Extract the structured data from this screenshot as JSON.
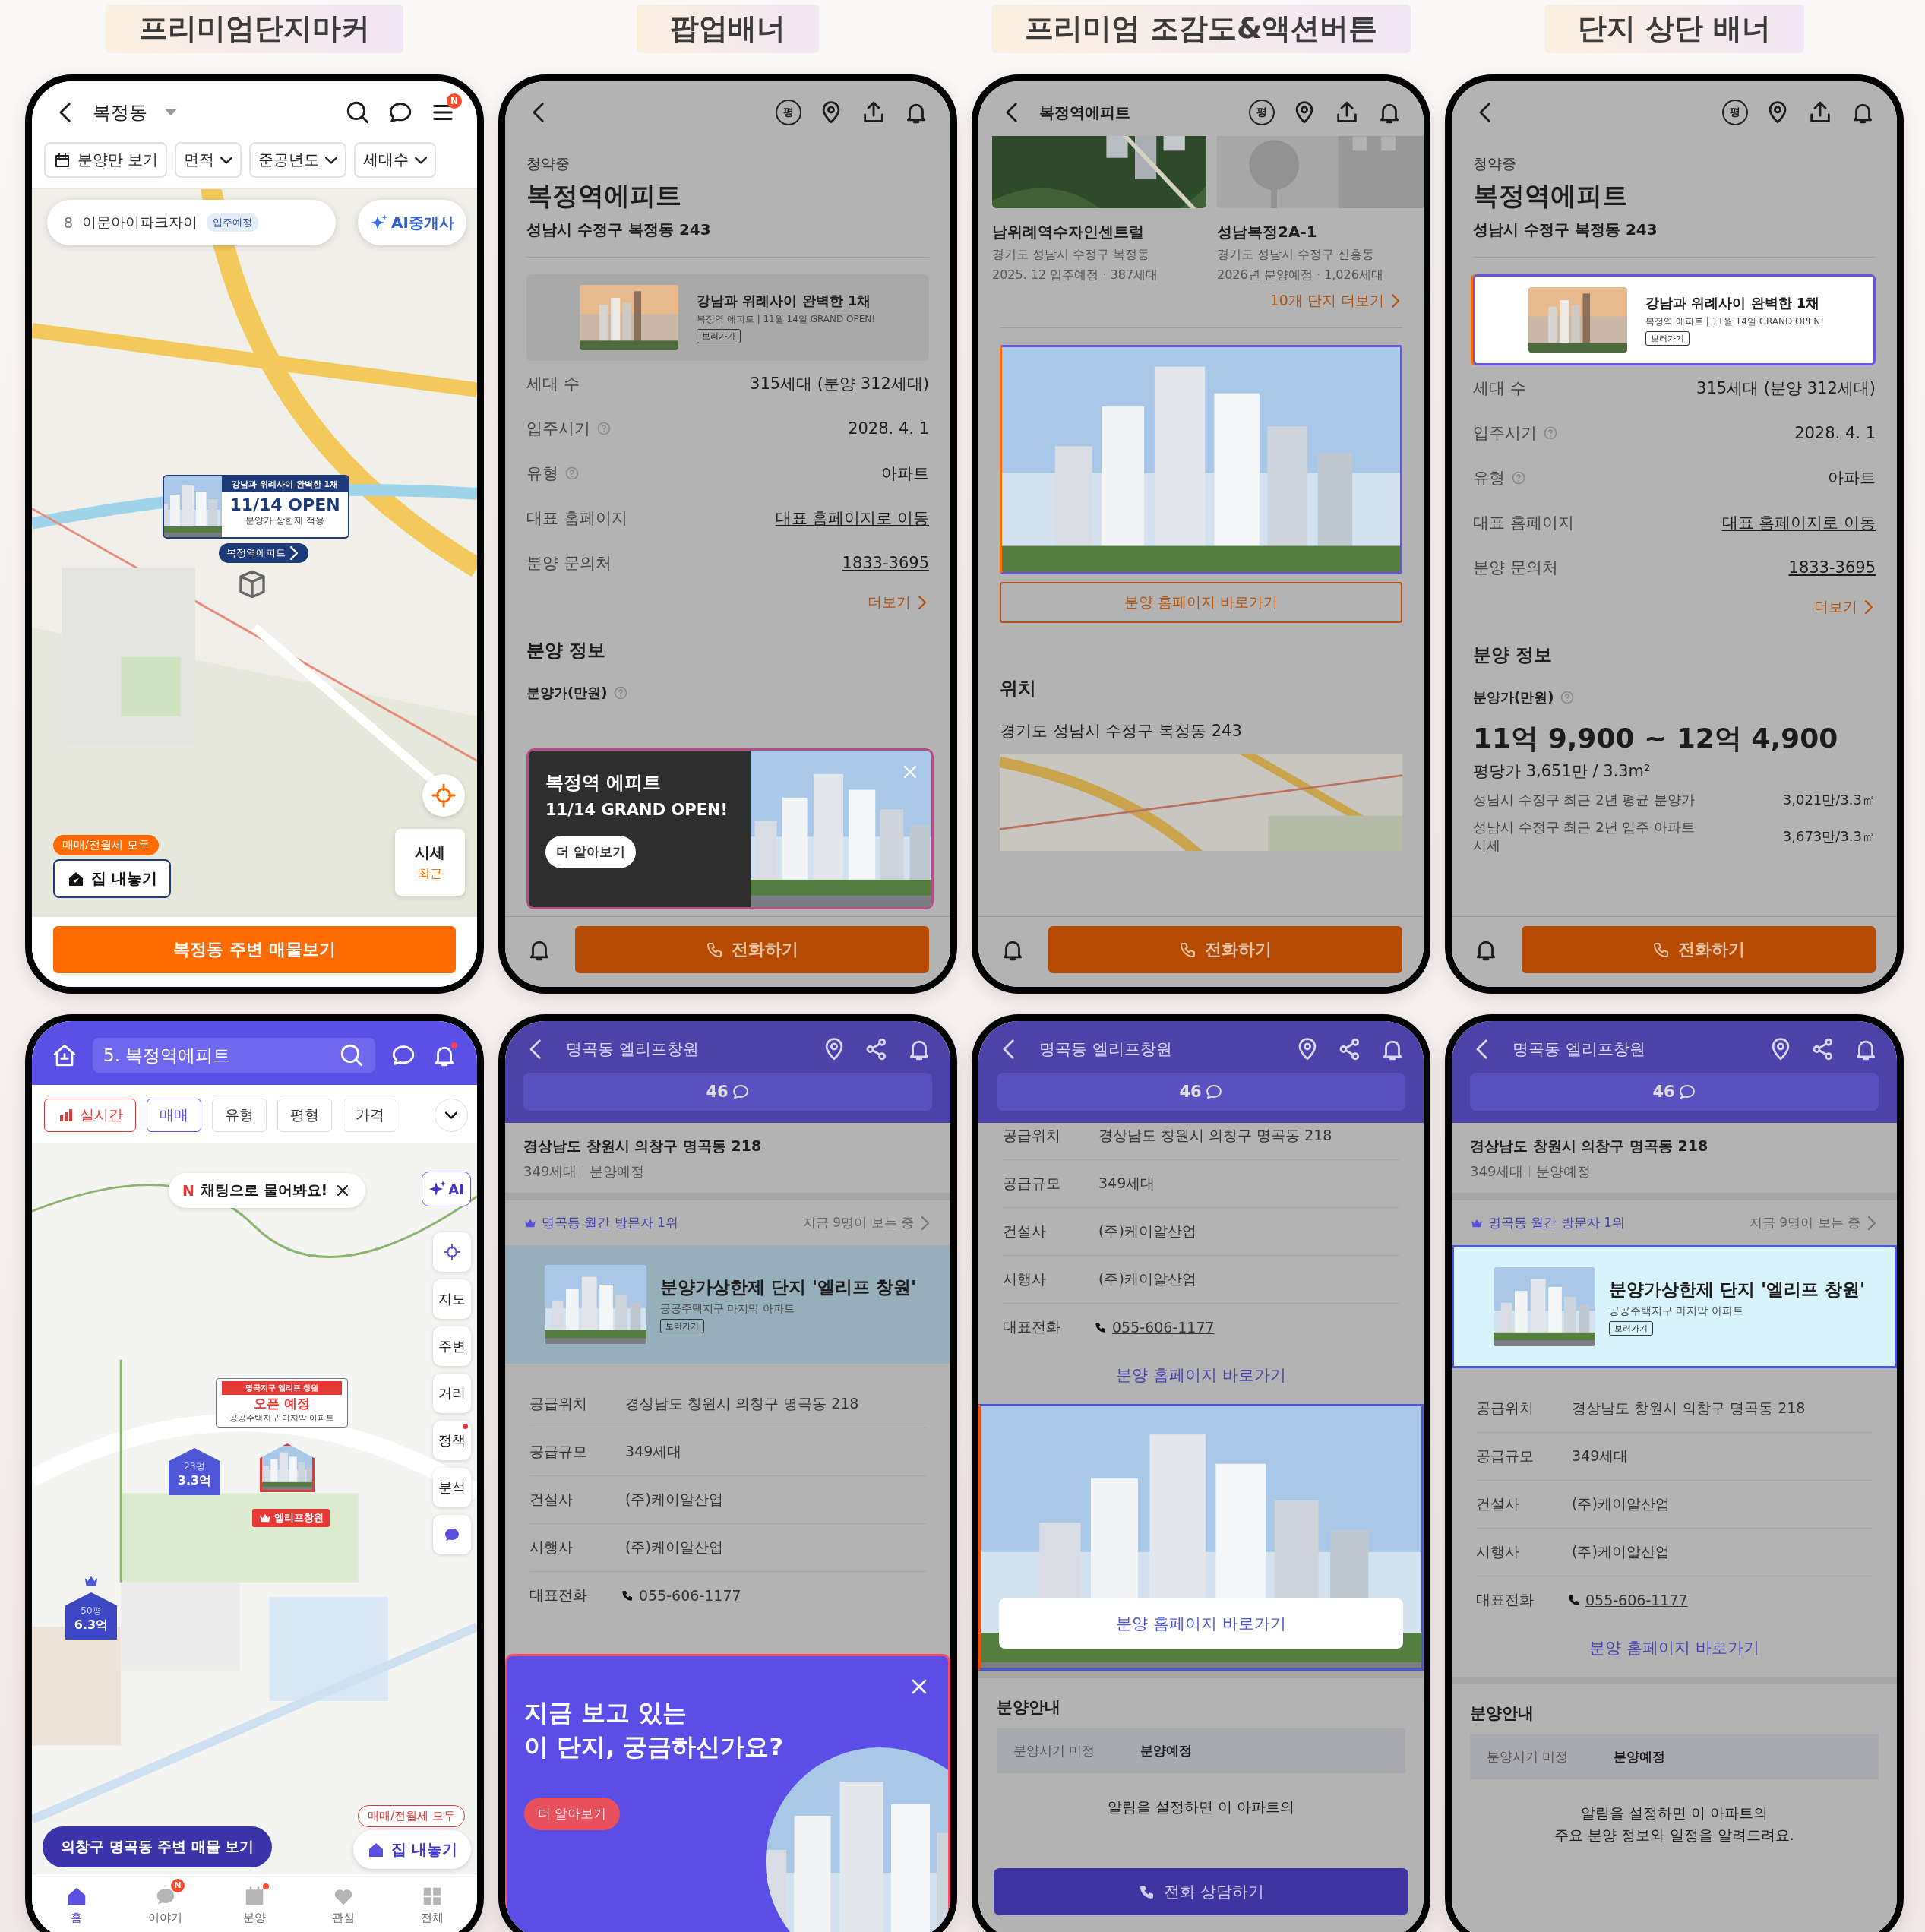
{
  "section_labels": [
    "프리미엄단지마커",
    "팝업배너",
    "프리미엄 조감도&액션버튼",
    "단지 상단 배너"
  ],
  "phones": [
    {
      "kind": "map_orange",
      "title": "복정동",
      "menu_badge": "N",
      "filters": [
        {
          "label": "분양만 보기",
          "kind": "toggle"
        },
        {
          "label": "면적",
          "kind": "dropdown"
        },
        {
          "label": "준공년도",
          "kind": "dropdown"
        },
        {
          "label": "세대수",
          "kind": "dropdown"
        }
      ],
      "search_chip": {
        "rank": "8",
        "name": "이문아이파크자이",
        "tag": "입주예정"
      },
      "ai_button": "AI중개사",
      "premium_marker": {
        "headline": "강남과 위례사이 완벽한 1채",
        "date": "11/14 OPEN",
        "note": "분양가 상한제 적용",
        "pin_label": "복정역에피트"
      },
      "sell_badge": "매매/전월세 모두",
      "sell_button": "집 내놓기",
      "price_card": {
        "title": "시세",
        "sub": "최근"
      },
      "bottom_button": "복정동 주변 매물보기"
    },
    {
      "kind": "detail_orange",
      "dimmed": true,
      "unit_icon": "평",
      "status": "청약중",
      "title": "복정역에피트",
      "address": "성남시 수정구 복정동 243",
      "banner": {
        "highlighted": false,
        "title": "강남과 위례사이 완벽한 1채",
        "sub": "복정역 에피트 | 11월 14일 GRAND OPEN!",
        "button": "보러가기"
      },
      "rows": [
        {
          "label": "세대 수",
          "value": "315세대 (분양 312세대)",
          "help": false,
          "link": false
        },
        {
          "label": "입주시기",
          "value": "2028. 4. 1",
          "help": true,
          "link": false
        },
        {
          "label": "유형",
          "value": "아파트",
          "help": true,
          "link": false
        },
        {
          "label": "대표 홈페이지",
          "value": "대표 홈페이지로 이동",
          "help": false,
          "link": true
        },
        {
          "label": "분양 문의처",
          "value": "1833-3695",
          "help": false,
          "link": true
        }
      ],
      "more": "더보기",
      "section": "분양 정보",
      "price_label": "분양가(만원)",
      "popup": {
        "title": "복정역 에피트",
        "sub": "11/14 GRAND OPEN!",
        "button": "더 알아보기"
      },
      "call_button": "전화하기"
    },
    {
      "kind": "detail_scrolled",
      "dimmed": true,
      "unit_icon": "평",
      "title": "복정역에피트",
      "nearby": [
        {
          "name": "남위례역수자인센트럴",
          "address": "경기도 성남시 수정구 복정동",
          "detail": "2025. 12 입주예정 · 387세대"
        },
        {
          "name": "성남복정2A-1",
          "address": "경기도 성남시 수정구 신흥동",
          "detail": "2026년 분양예정 · 1,026세대"
        }
      ],
      "more": "10개 단지 더보기",
      "homepage_button": "분양 홈페이지 바로가기",
      "section": "위치",
      "address": "경기도 성남시 수정구 복정동 243",
      "call_button": "전화하기"
    },
    {
      "kind": "detail_orange",
      "dimmed": true,
      "unit_icon": "평",
      "status": "청약중",
      "title": "복정역에피트",
      "address": "성남시 수정구 복정동 243",
      "banner": {
        "highlighted": true,
        "title": "강남과 위례사이 완벽한 1채",
        "sub": "복정역 에피트 | 11월 14일 GRAND OPEN!",
        "button": "보러가기"
      },
      "rows": [
        {
          "label": "세대 수",
          "value": "315세대 (분양 312세대)",
          "help": false,
          "link": false
        },
        {
          "label": "입주시기",
          "value": "2028. 4. 1",
          "help": true,
          "link": false
        },
        {
          "label": "유형",
          "value": "아파트",
          "help": true,
          "link": false
        },
        {
          "label": "대표 홈페이지",
          "value": "대표 홈페이지로 이동",
          "help": false,
          "link": true
        },
        {
          "label": "분양 문의처",
          "value": "1833-3695",
          "help": false,
          "link": true
        }
      ],
      "more": "더보기",
      "section": "분양 정보",
      "price_label": "분양가(만원)",
      "price": {
        "range": "11억 9,900 ~ 12억 4,900",
        "per_pyeong": "평당가 3,651만 / 3.3m²",
        "compare": [
          {
            "label": "성남시 수정구 최근 2년 평균 분양가",
            "value": "3,021만/3.3㎡"
          },
          {
            "label": "성남시 수정구 최근 2년 입주 아파트 시세",
            "value": "3,673만/3.3㎡"
          }
        ]
      },
      "call_button": "전화하기"
    },
    {
      "kind": "map_purple",
      "search": "5. 복정역에피트",
      "filters": [
        {
          "label": "실시간",
          "kind": "live",
          "selected": false
        },
        {
          "label": "매매",
          "kind": "chip",
          "selected": true
        },
        {
          "label": "유형",
          "kind": "chip",
          "selected": false
        },
        {
          "label": "평형",
          "kind": "chip",
          "selected": false
        },
        {
          "label": "가격",
          "kind": "chip",
          "selected": false
        }
      ],
      "chat_hint": {
        "badge": "N",
        "text": "채팅으로 물어봐요!"
      },
      "ai_button": "AI",
      "side_buttons": [
        {
          "label": "지도",
          "dot": false
        },
        {
          "label": "주변",
          "dot": false
        },
        {
          "label": "거리",
          "dot": false
        },
        {
          "label": "정책",
          "dot": true
        },
        {
          "label": "분석",
          "dot": false
        }
      ],
      "premium_marker": {
        "headline": "명곡지구 엘리프 창원",
        "status": "오픈 예정",
        "note": "공공주택지구 마지막 아파트",
        "pin_label": "엘리프창원"
      },
      "price_markers": [
        {
          "size": "23평",
          "price": "3.3억",
          "crown": false
        },
        {
          "size": "50평",
          "price": "6.3억",
          "crown": true
        }
      ],
      "area_button": "의창구 명곡동 주변 매물 보기",
      "sell_badge": "매매/전월세 모두",
      "sell_button": "집 내놓기",
      "tabs": [
        {
          "label": "홈",
          "selected": true,
          "dot": false
        },
        {
          "label": "이야기",
          "selected": false,
          "dot": false,
          "badge": "N"
        },
        {
          "label": "분양",
          "selected": false,
          "dot": true
        },
        {
          "label": "관심",
          "selected": false,
          "dot": false
        },
        {
          "label": "전체",
          "selected": false,
          "dot": false
        }
      ]
    },
    {
      "kind": "detail_purple",
      "dimmed": true,
      "title": "명곡동 엘리프창원",
      "comments": "46",
      "address": "경상남도 창원시 의창구 명곡동 218",
      "meta": [
        "349세대",
        "분양예정"
      ],
      "rank": "명곡동 월간 방문자 1위",
      "viewers": "지금 9명이 보는 중",
      "banner": {
        "highlighted": false,
        "title": "분양가상한제 단지 '엘리프 창원'",
        "sub": "공공주택지구 마지막 아파트",
        "button": "보러가기"
      },
      "rows": [
        {
          "label": "공급위치",
          "value": "경상남도 창원시 의창구 명곡동 218",
          "kind": "text"
        },
        {
          "label": "공급규모",
          "value": "349세대",
          "kind": "text"
        },
        {
          "label": "건설사",
          "value": "(주)케이알산업",
          "kind": "text"
        },
        {
          "label": "시행사",
          "value": "(주)케이알산업",
          "kind": "text"
        },
        {
          "label": "대표전화",
          "value": "055-606-1177",
          "kind": "phone"
        }
      ],
      "popup": {
        "lines": [
          "지금 보고 있는",
          "이 단지, 궁금하신가요?"
        ],
        "button": "더 알아보기"
      }
    },
    {
      "kind": "purple_scrolled",
      "dimmed": true,
      "title": "명곡동 엘리프창원",
      "comments": "46",
      "rows": [
        {
          "label": "공급위치",
          "value": "경상남도 창원시 의창구 명곡동 218",
          "kind": "text"
        },
        {
          "label": "공급규모",
          "value": "349세대",
          "kind": "text"
        },
        {
          "label": "건설사",
          "value": "(주)케이알산업",
          "kind": "text"
        },
        {
          "label": "시행사",
          "value": "(주)케이알산업",
          "kind": "text"
        },
        {
          "label": "대표전화",
          "value": "055-606-1177",
          "kind": "phone"
        }
      ],
      "homepage_link": "분양 홈페이지 바로가기",
      "picture_button": "분양 홈페이지 바로가기",
      "section": "분양안내",
      "schedule": {
        "label": "분양시기 미정",
        "value": "분양예정"
      },
      "notice": [
        "알림을 설정하면 이 아파트의"
      ],
      "call_button": "전화 상담하기"
    },
    {
      "kind": "detail_purple",
      "dimmed": true,
      "title": "명곡동 엘리프창원",
      "comments": "46",
      "address": "경상남도 창원시 의창구 명곡동 218",
      "meta": [
        "349세대",
        "분양예정"
      ],
      "rank": "명곡동 월간 방문자 1위",
      "viewers": "지금 9명이 보는 중",
      "banner": {
        "highlighted": true,
        "title": "분양가상한제 단지 '엘리프 창원'",
        "sub": "공공주택지구 마지막 아파트",
        "button": "보러가기"
      },
      "rows": [
        {
          "label": "공급위치",
          "value": "경상남도 창원시 의창구 명곡동 218",
          "kind": "text"
        },
        {
          "label": "공급규모",
          "value": "349세대",
          "kind": "text"
        },
        {
          "label": "건설사",
          "value": "(주)케이알산업",
          "kind": "text"
        },
        {
          "label": "시행사",
          "value": "(주)케이알산업",
          "kind": "text"
        },
        {
          "label": "대표전화",
          "value": "055-606-1177",
          "kind": "phone"
        }
      ],
      "homepage_link": "분양 홈페이지 바로가기",
      "section": "분양안내",
      "schedule": {
        "label": "분양시기 미정",
        "value": "분양예정"
      },
      "notice": [
        "알림을 설정하면 이 아파트의",
        "주요 분양 정보와 일정을 알려드려요."
      ]
    }
  ]
}
